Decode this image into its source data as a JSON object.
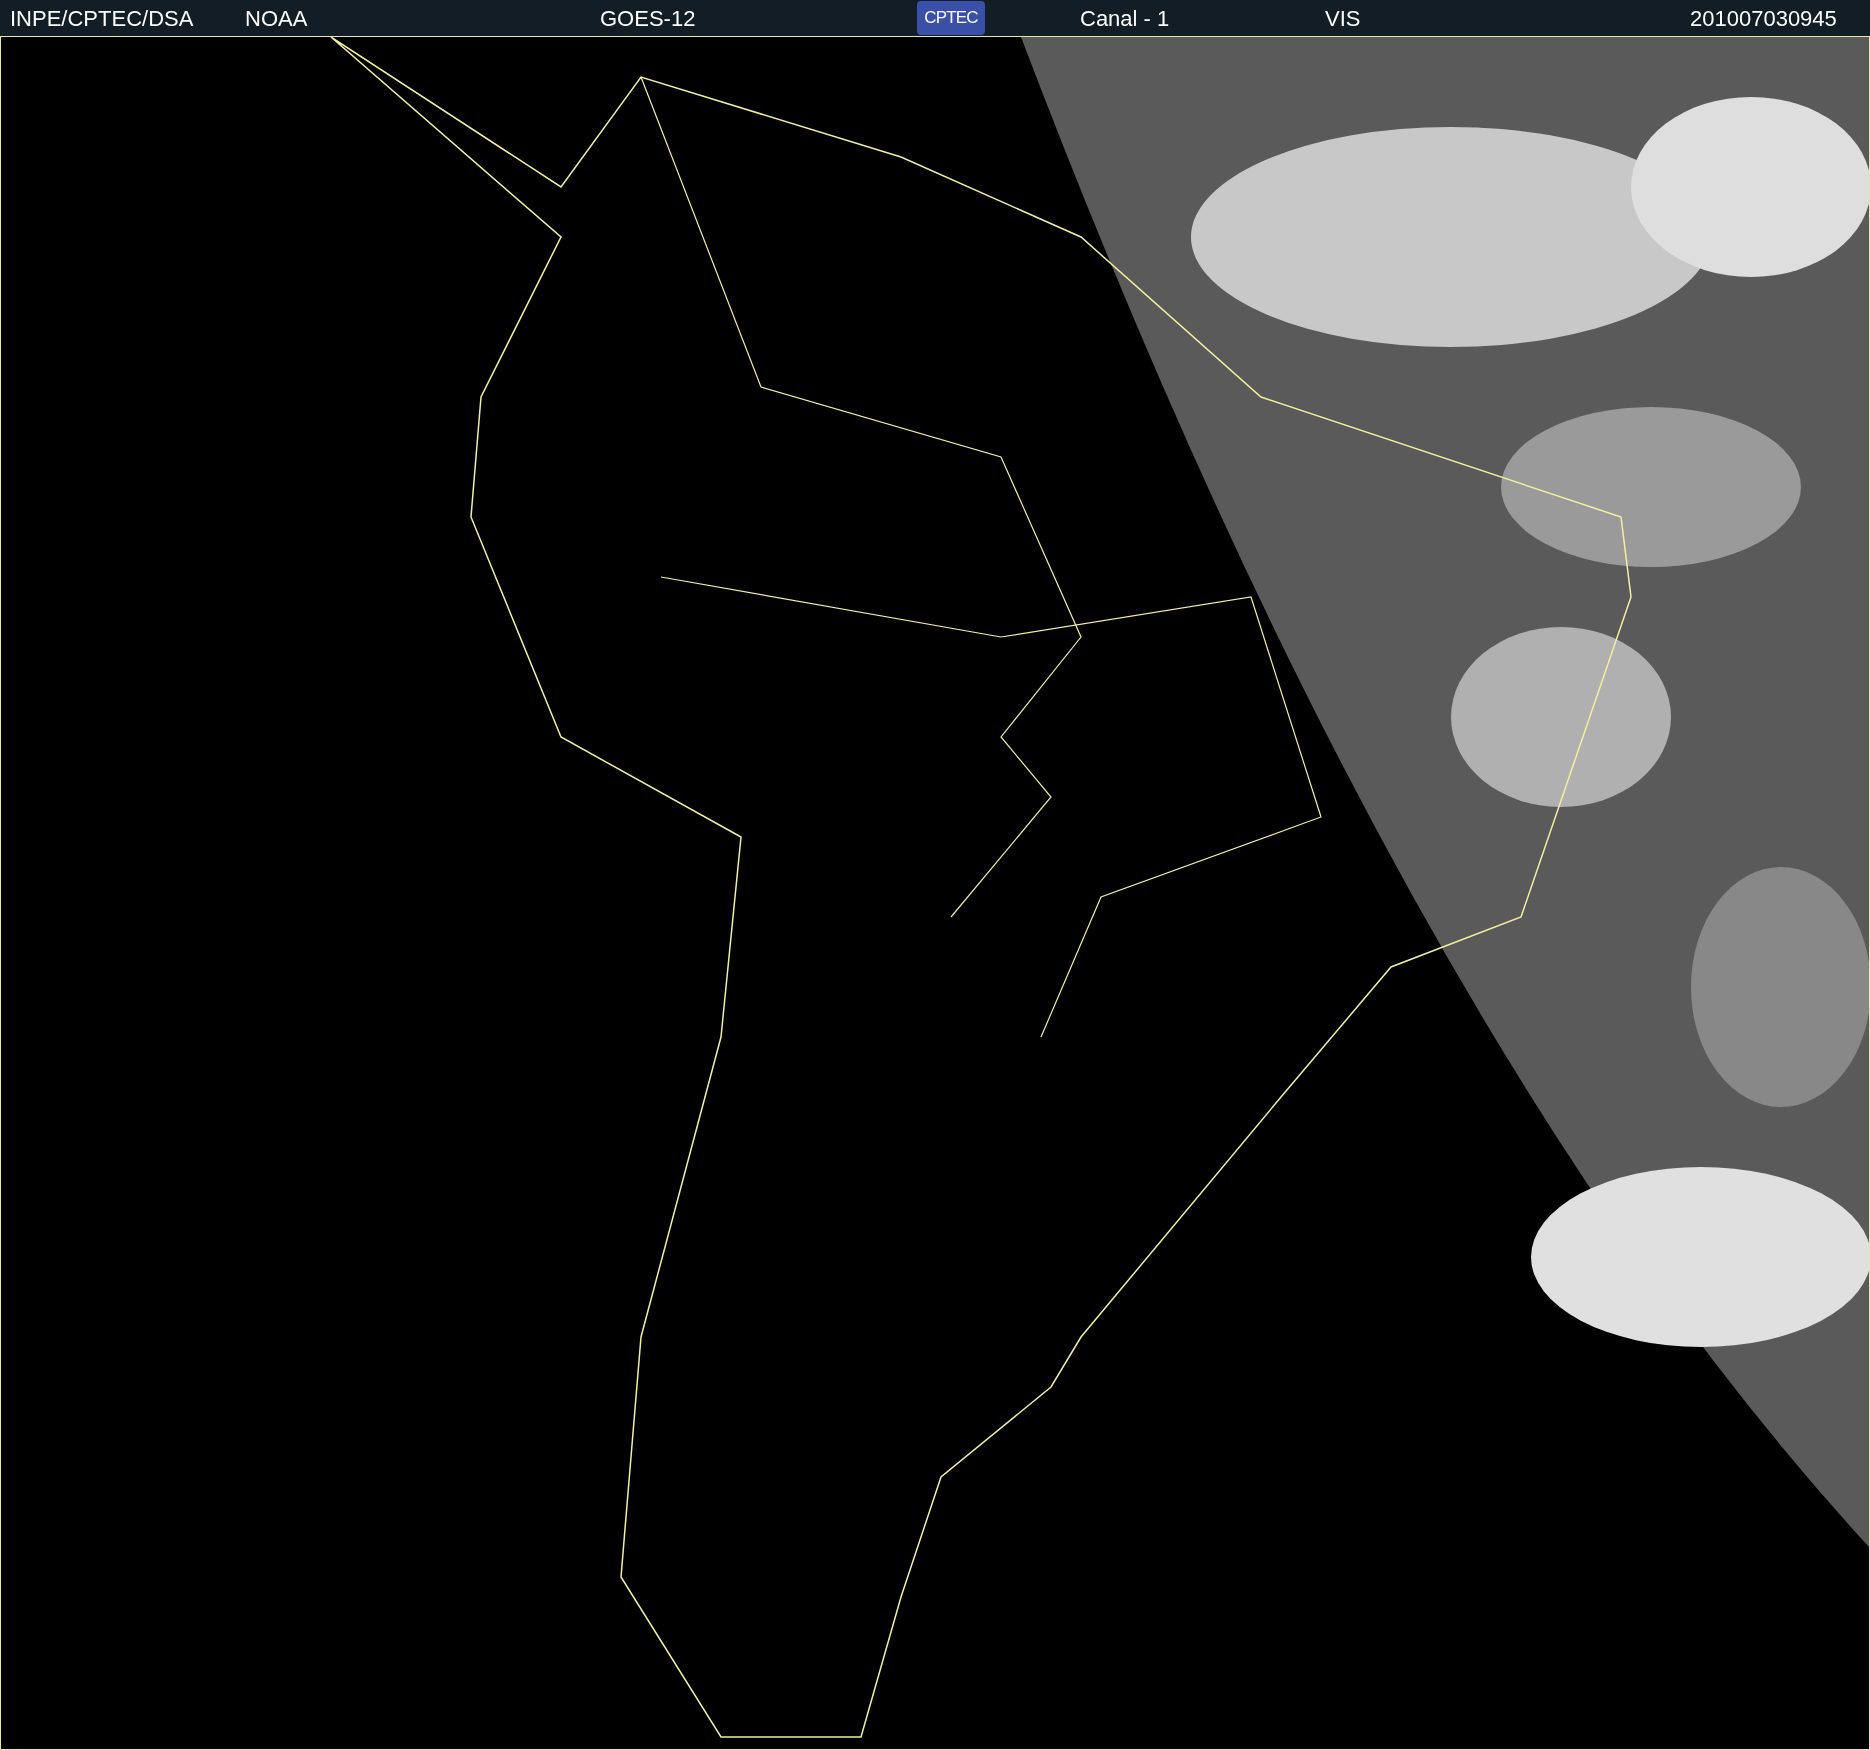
{
  "header": {
    "items": [
      {
        "kind": "text",
        "text": "INPE/CPTEC/DSA"
      },
      {
        "kind": "text",
        "text": "NOAA"
      },
      {
        "kind": "text",
        "text": "GOES-12"
      },
      {
        "kind": "logo",
        "text": "CPTEC"
      },
      {
        "kind": "text",
        "text": "Canal - 1"
      },
      {
        "kind": "text",
        "text": "VIS"
      },
      {
        "kind": "text",
        "text": "201007030945"
      }
    ]
  }
}
